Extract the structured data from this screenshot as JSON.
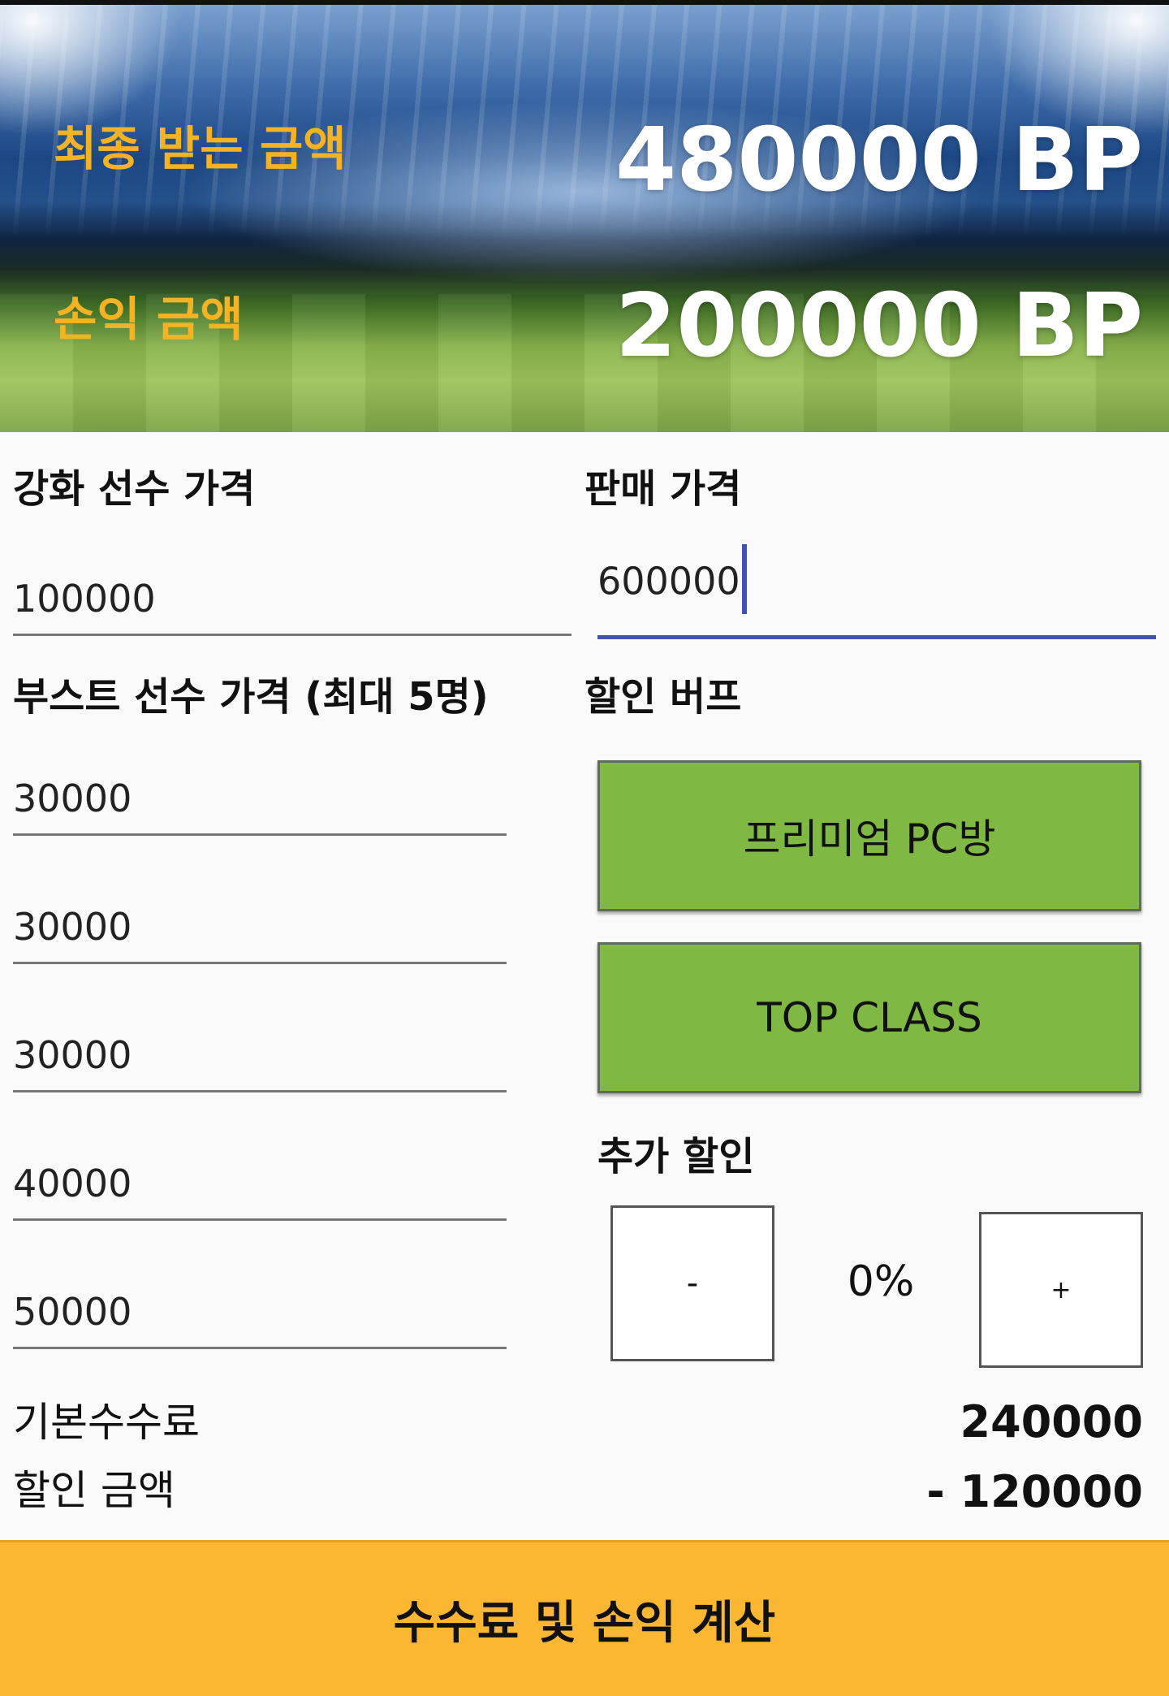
{
  "hero": {
    "final_label": "최종 받는 금액",
    "final_value": "480000 BP",
    "profit_label": "손익 금액",
    "profit_value": "200000 BP"
  },
  "enhance": {
    "label": "강화 선수 가격",
    "value": "100000"
  },
  "sale": {
    "label": "판매 가격",
    "value": "600000"
  },
  "boost": {
    "label": "부스트 선수 가격 (최대 5명)",
    "values": [
      "30000",
      "30000",
      "30000",
      "40000",
      "50000"
    ]
  },
  "discount_buff": {
    "label": "할인 버프",
    "buttons": [
      "프리미엄 PC방",
      "TOP CLASS"
    ]
  },
  "extra_discount": {
    "label": "추가 할인",
    "minus": "-",
    "value": "0%",
    "plus": "+"
  },
  "fees": {
    "base_label": "기본수수료",
    "base_value": "240000",
    "discount_label": "할인 금액",
    "discount_value": "- 120000"
  },
  "calculate_button": "수수료 및 손익 계산",
  "colors": {
    "accent": "#f5b324",
    "button_green": "#7fb842",
    "cta": "#fbb731",
    "focus": "#3f51b5"
  }
}
